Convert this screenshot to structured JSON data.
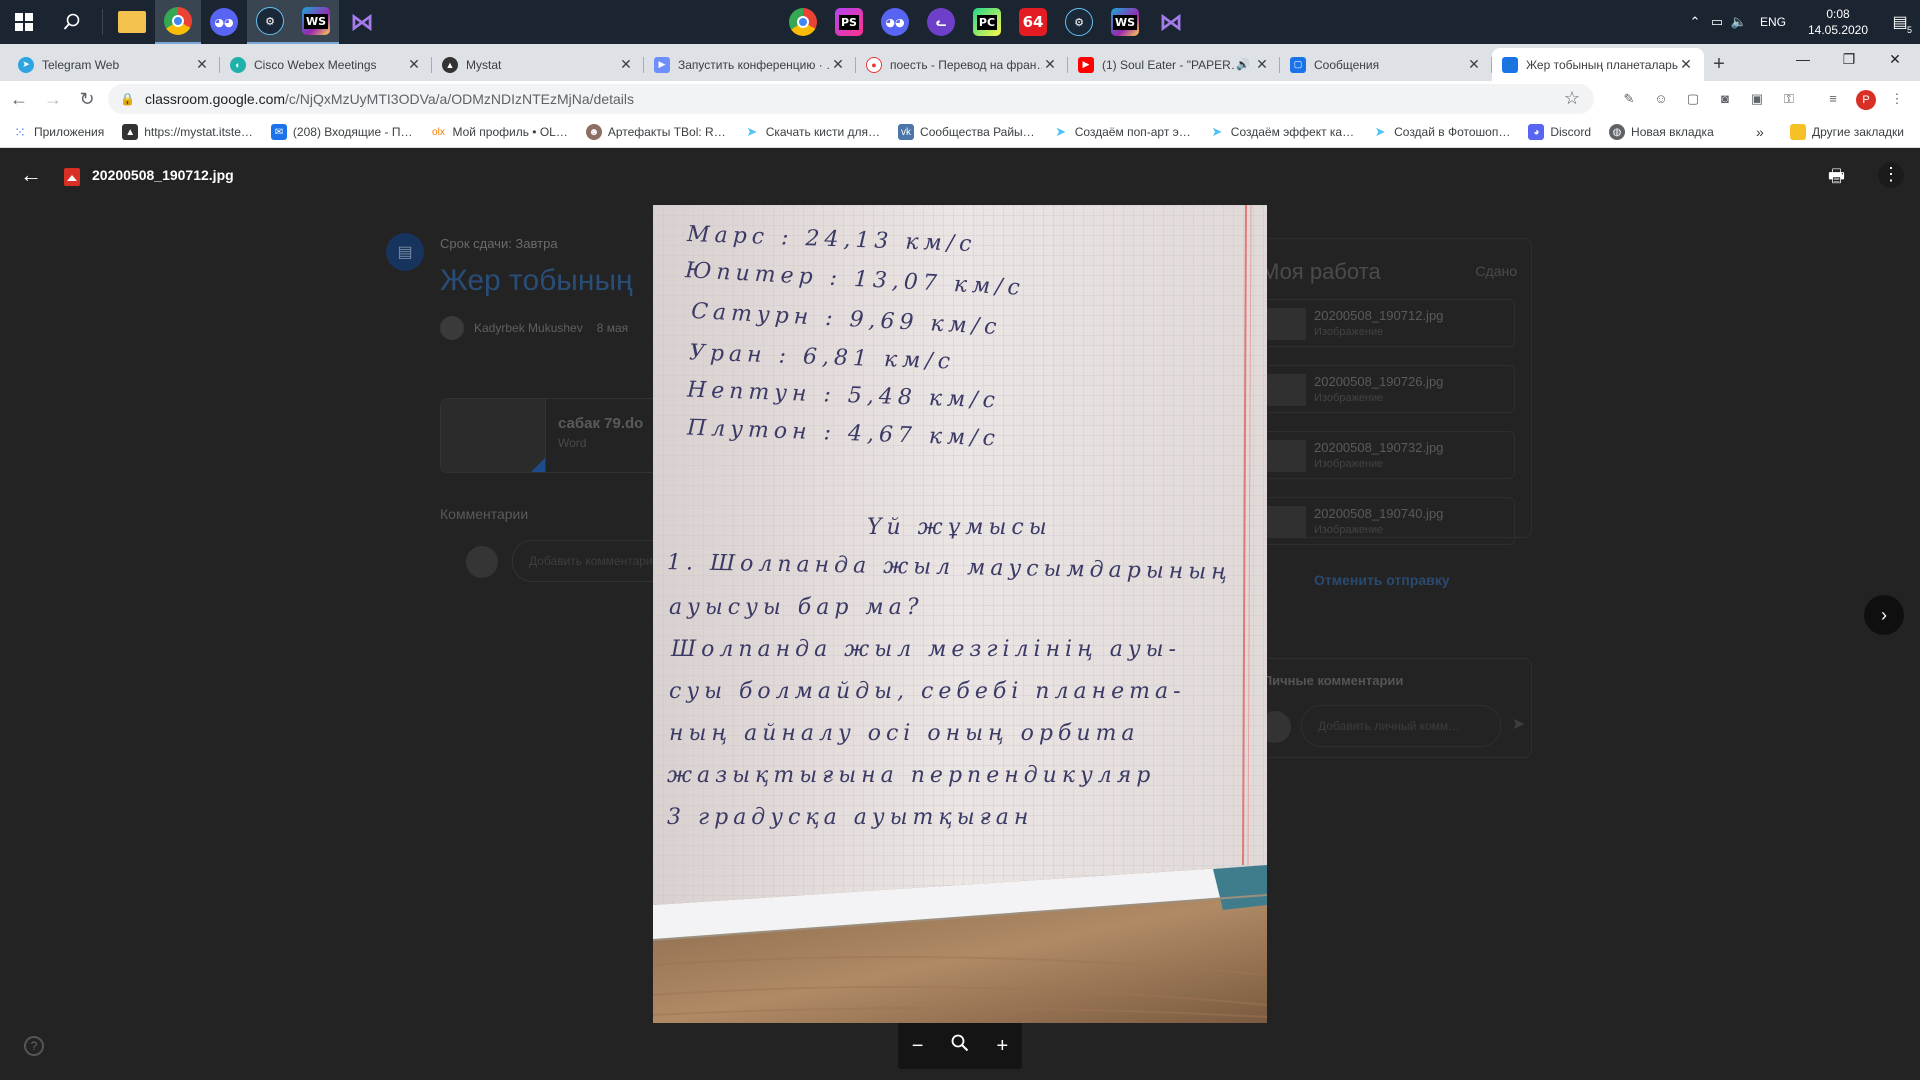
{
  "taskbar": {
    "apps": [
      {
        "name": "file-explorer",
        "icon": "folder-icon",
        "color": "#f2c14e"
      },
      {
        "name": "chrome",
        "icon": "chrome-icon",
        "color": "#4285f4",
        "active": true
      },
      {
        "name": "discord",
        "icon": "discord-icon",
        "color": "#5865f2"
      },
      {
        "name": "steam",
        "icon": "steam-icon",
        "color": "#1b2838"
      },
      {
        "name": "webstorm",
        "icon": "webstorm-icon",
        "color": "#15a9d8",
        "label": "WS"
      },
      {
        "name": "visual-studio",
        "icon": "visual-studio-icon",
        "color": "#7e57c2"
      }
    ],
    "center_apps": [
      {
        "name": "chrome",
        "icon": "chrome-icon",
        "color": "#4285f4"
      },
      {
        "name": "phpstorm",
        "icon": "phpstorm-icon",
        "color": "#b345f1",
        "label": "PS"
      },
      {
        "name": "discord",
        "icon": "discord-icon",
        "color": "#5865f2"
      },
      {
        "name": "github-desktop",
        "icon": "cat-icon",
        "color": "#6e40c9"
      },
      {
        "name": "pycharm",
        "icon": "pycharm-icon",
        "color": "#21d789",
        "label": "PC"
      },
      {
        "name": "aida64",
        "icon": "aida-icon",
        "color": "#e31b23",
        "label": "64"
      },
      {
        "name": "steam",
        "icon": "steam-icon",
        "color": "#1b2838"
      },
      {
        "name": "webstorm",
        "icon": "webstorm-icon",
        "color": "#15a9d8",
        "label": "WS"
      },
      {
        "name": "visual-studio",
        "icon": "visual-studio-icon",
        "color": "#7e57c2"
      }
    ],
    "language": "ENG",
    "time": "0:08",
    "date": "14.05.2020",
    "notifications": "5"
  },
  "tabs": [
    {
      "title": "Telegram Web",
      "color": "#2ca5e0"
    },
    {
      "title": "Cisco Webex Meetings",
      "color": "#20b2aa"
    },
    {
      "title": "Mystat",
      "color": "#333333"
    },
    {
      "title": "Запустить конференцию · …",
      "color": "#6e8efb"
    },
    {
      "title": "поесть - Перевод на фран…",
      "color": "#e53935"
    },
    {
      "title": "(1) Soul Eater - \"PAPER…",
      "color": "#ff0000"
    },
    {
      "title": "Сообщения",
      "color": "#1a73e8"
    },
    {
      "title": "Жер тобының планеталары",
      "color": "#1a73e8",
      "active": true
    }
  ],
  "address": {
    "host": "classroom.google.com",
    "path": "/c/NjQxMzUyMTI3ODVa/a/ODMzNDIzNTEzMjNa/details"
  },
  "bookmarks": [
    {
      "label": "Приложения",
      "color": "#4285f4"
    },
    {
      "label": "https://mystat.itste…",
      "color": "#333333"
    },
    {
      "label": "(208) Входящие - П…",
      "color": "#1a73e8"
    },
    {
      "label": "Мой профиль • OL…",
      "color": "#f57c00"
    },
    {
      "label": "Артефакты ТBol: R…",
      "color": "#8d6e63"
    },
    {
      "label": "Скачать кисти для…",
      "color": "#4fc3f7"
    },
    {
      "label": "Сообщества Райы…",
      "color": "#4a76a8"
    },
    {
      "label": "Создаём поп-арт э…",
      "color": "#4fc3f7"
    },
    {
      "label": "Создаём эффект ка…",
      "color": "#4fc3f7"
    },
    {
      "label": "Создай в Фотошоп…",
      "color": "#4fc3f7"
    },
    {
      "label": "Discord",
      "color": "#5865f2"
    },
    {
      "label": "Новая вкладка",
      "color": "#5f6368"
    }
  ],
  "other_bookmarks": "Другие закладки",
  "viewer": {
    "file_name": "20200508_190712.jpg",
    "handwriting": [
      "Марс : 24,13 км/с",
      "Юпитер : 13,07 км/с",
      "Сатурн : 9,69 км/с",
      "Уран : 6,81 км/с",
      "Нептун : 5,48 км/с",
      "Плутон : 4,67 км/с",
      "Үй жұмысы",
      "1. Шолпанда жыл маусымдарының",
      "ауысуы бар ма?",
      "Шолпанда жыл мезгілінің ауы-",
      "суы болмайды, себебі планета-",
      "ның айналу осі оның орбита",
      "жазықтығына перпендикуляр",
      "3 градусқа ауытқыған"
    ]
  },
  "page": {
    "due": "Срок сдачи: Завтра",
    "title": "Жер тобының",
    "author": "Kadyrbek Mukushev",
    "posted": "8 мая",
    "attachment_name": "сабак 79.do",
    "attachment_type": "Word",
    "comments_label": "Комментарии",
    "comment_placeholder": "Добавить комментарий",
    "my_work_title": "Моя работа",
    "my_work_status": "Сдано",
    "files": [
      {
        "name": "20200508_190712.jpg",
        "type": "Изображение"
      },
      {
        "name": "20200508_190726.jpg",
        "type": "Изображение"
      },
      {
        "name": "20200508_190732.jpg",
        "type": "Изображение"
      },
      {
        "name": "20200508_190740.jpg",
        "type": "Изображение"
      }
    ],
    "unsubmit": "Отменить отправку",
    "private_comments": "Личные комментарии",
    "private_placeholder": "Добавить личный комм…"
  }
}
